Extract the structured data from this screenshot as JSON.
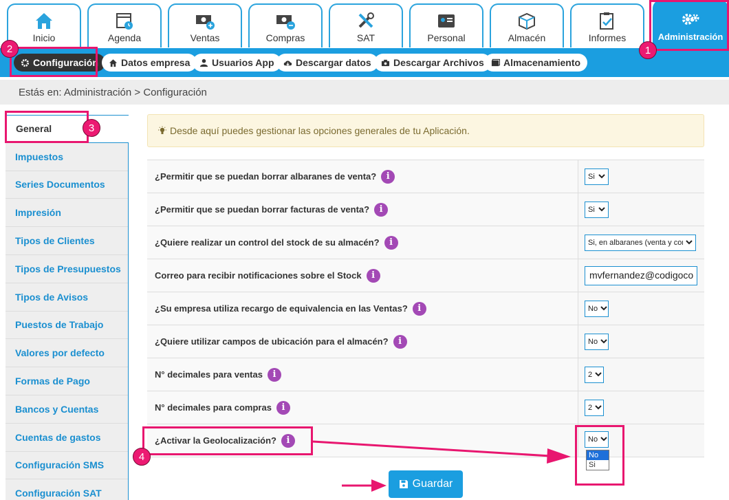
{
  "tabs": [
    {
      "label": "Inicio",
      "icon": "home-icon"
    },
    {
      "label": "Agenda",
      "icon": "calendar-icon"
    },
    {
      "label": "Ventas",
      "icon": "money-plus-icon"
    },
    {
      "label": "Compras",
      "icon": "money-minus-icon"
    },
    {
      "label": "SAT",
      "icon": "tools-icon"
    },
    {
      "label": "Personal",
      "icon": "id-card-icon"
    },
    {
      "label": "Almacén",
      "icon": "boxes-icon"
    },
    {
      "label": "Informes",
      "icon": "clipboard-icon"
    },
    {
      "label": "Administración",
      "icon": "gears-icon"
    }
  ],
  "subnav": [
    {
      "label": "Configuración",
      "icon": "gear-icon"
    },
    {
      "label": "Datos empresa",
      "icon": "home-icon"
    },
    {
      "label": "Usuarios App",
      "icon": "user-icon"
    },
    {
      "label": "Descargar datos",
      "icon": "cloud-download-icon"
    },
    {
      "label": "Descargar Archivos",
      "icon": "camera-icon"
    },
    {
      "label": "Almacenamiento",
      "icon": "folder-icon"
    }
  ],
  "breadcrumb": "Estás en: Administración > Configuración",
  "sidebar": [
    "General",
    "Impuestos",
    "Series Documentos",
    "Impresión",
    "Tipos de Clientes",
    "Tipos de Presupuestos",
    "Tipos de Avisos",
    "Puestos de Trabajo",
    "Valores por defecto",
    "Formas de Pago",
    "Bancos y Cuentas",
    "Cuentas de gastos",
    "Configuración SMS",
    "Configuración SAT"
  ],
  "info_text": "Desde aquí puedes gestionar las opciones generales de tu Aplicación.",
  "settings": [
    {
      "question": "¿Permitir que se puedan borrar albaranes de venta?",
      "value": "Si"
    },
    {
      "question": "¿Permitir que se puedan borrar facturas de venta?",
      "value": "Si"
    },
    {
      "question": "¿Quiere realizar un control del stock de su almacén?",
      "value": "Si, en albaranes (venta y com"
    },
    {
      "question": "Correo para recibir notificaciones sobre el Stock",
      "value": "mvfernandez@codigoco"
    },
    {
      "question": "¿Su empresa utiliza recargo de equivalencia en las Ventas?",
      "value": "No"
    },
    {
      "question": "¿Quiere utilizar campos de ubicación para el almacén?",
      "value": "No"
    },
    {
      "question": "N° decimales para ventas",
      "value": "2"
    },
    {
      "question": "N° decimales para compras",
      "value": "2"
    },
    {
      "question": "¿Activar la Geolocalización?",
      "value": "No"
    }
  ],
  "info_glyph": "i",
  "geo_options": [
    "No",
    "Si"
  ],
  "save_label": "Guardar",
  "badges": [
    "1",
    "2",
    "3",
    "4"
  ],
  "colors": {
    "primary": "#1b9ee0",
    "highlight": "#e8166f",
    "info_purple": "#a349b5"
  }
}
